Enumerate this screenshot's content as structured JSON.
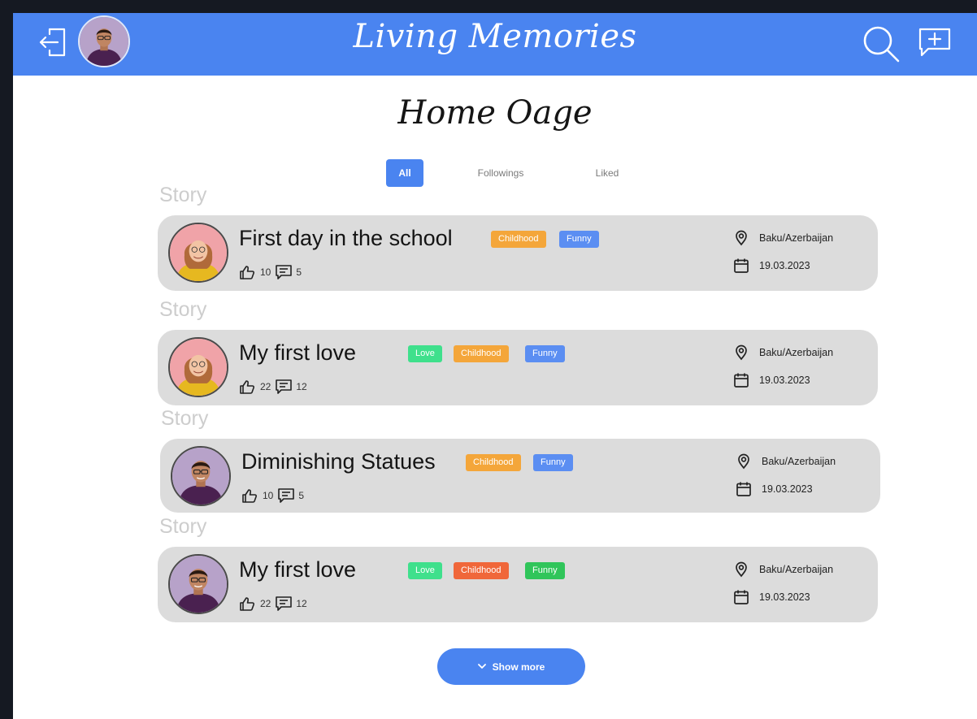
{
  "app": {
    "title": "Living Memories"
  },
  "page": {
    "title": "Home Oage"
  },
  "tabs": [
    {
      "label": "All",
      "active": true
    },
    {
      "label": "Followings",
      "active": false
    },
    {
      "label": "Liked",
      "active": false
    }
  ],
  "stories": [
    {
      "section_label": "Story",
      "title": "First day in the school",
      "avatar": "woman",
      "tags": [
        {
          "label": "Childhood",
          "color": "#f4a63a"
        },
        {
          "label": "Funny",
          "color": "#5b8ef2"
        }
      ],
      "likes": "10",
      "comments": "5",
      "location": "Baku/Azerbaijan",
      "date": "19.03.2023"
    },
    {
      "section_label": "Story",
      "title": "My first love",
      "avatar": "woman",
      "tags": [
        {
          "label": "Love",
          "color": "#3fe08c"
        },
        {
          "label": "Childhood",
          "color": "#f4a63a"
        },
        {
          "label": "Funny",
          "color": "#5b8ef2"
        }
      ],
      "likes": "22",
      "comments": "12",
      "location": "Baku/Azerbaijan",
      "date": "19.03.2023"
    },
    {
      "section_label": "Story",
      "title": "Diminishing Statues",
      "avatar": "man",
      "tags": [
        {
          "label": "Childhood",
          "color": "#f4a63a"
        },
        {
          "label": "Funny",
          "color": "#5b8ef2"
        }
      ],
      "likes": "10",
      "comments": "5",
      "location": "Baku/Azerbaijan",
      "date": "19.03.2023"
    },
    {
      "section_label": "Story",
      "title": "My first love",
      "avatar": "man",
      "tags": [
        {
          "label": "Love",
          "color": "#3fe08c"
        },
        {
          "label": "Childhood",
          "color": "#f0673a"
        },
        {
          "label": "Funny",
          "color": "#30c55a"
        }
      ],
      "likes": "22",
      "comments": "12",
      "location": "Baku/Azerbaijan",
      "date": "19.03.2023"
    }
  ],
  "show_more": {
    "label": "Show more"
  },
  "icons": {
    "logout": "logout-icon",
    "search": "search-icon",
    "compose": "add-message-icon",
    "like": "thumbs-up-icon",
    "comment": "comment-icon",
    "location": "location-pin-icon",
    "date": "calendar-icon",
    "chevron": "chevron-down-icon"
  },
  "colors": {
    "accent": "#4a84f0",
    "card": "#dcdcdc"
  }
}
